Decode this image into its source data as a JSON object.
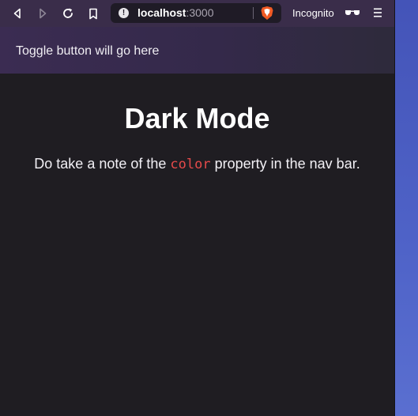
{
  "browser": {
    "url_host": "localhost",
    "url_port": ":3000",
    "incognito_label": "Incognito",
    "icons": {
      "back": "back-arrow-icon",
      "forward": "forward-arrow-icon",
      "reload": "reload-icon",
      "bookmark": "bookmark-icon",
      "site_info": "site-info-icon",
      "brave_shield": "brave-shield-icon",
      "incognito": "incognito-glasses-icon",
      "menu": "menu-icon"
    }
  },
  "nav": {
    "text": "Toggle button will go here"
  },
  "main": {
    "heading": "Dark Mode",
    "paragraph_before": "Do take a note of the ",
    "code_word": "color",
    "paragraph_after": " property in the nav bar."
  },
  "colors": {
    "page_background": "#1f1d22",
    "nav_background": "#3b2c52",
    "code_text": "#e54a4a",
    "toolbar": "#3a2d4a"
  }
}
